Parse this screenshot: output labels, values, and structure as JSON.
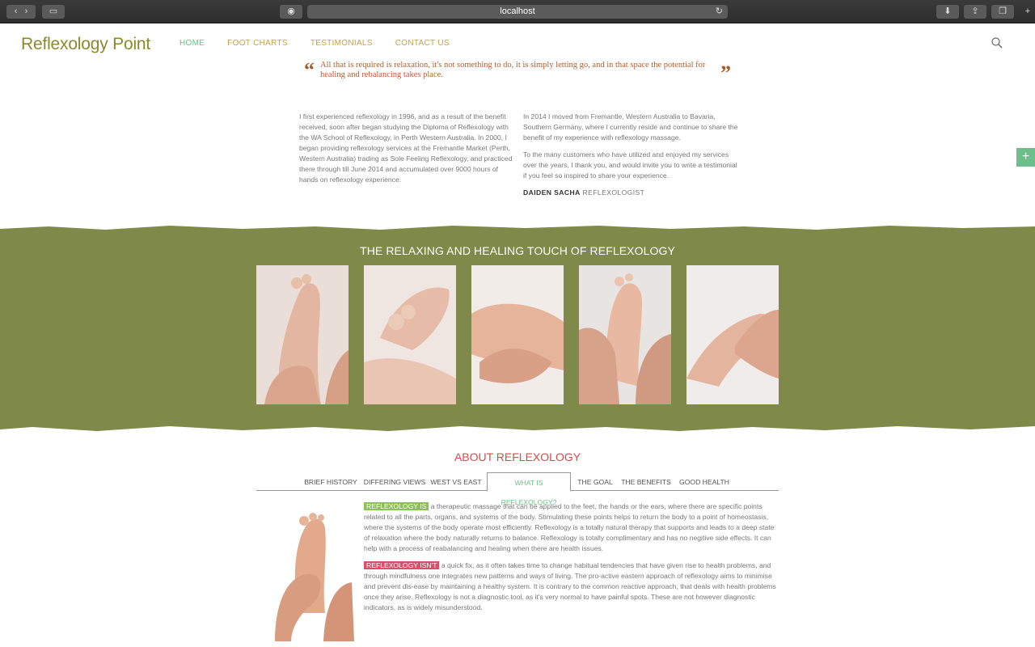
{
  "browser": {
    "url": "localhost"
  },
  "site": {
    "logo": "Reflexology Point",
    "nav": [
      "HOME",
      "FOOT CHARTS",
      "TESTIMONIALS",
      "CONTACT US"
    ],
    "active_nav": "HOME"
  },
  "quote": {
    "text": "All that is required is relaxation, it's not something to do, it is simply letting go, and in that space the potential for healing and rebalancing takes place."
  },
  "intro": {
    "left": "I first experienced reflexology in 1996, and as a result of the benefit received, soon after began studying the Diploma of Reflexology with the WA School of Reflexology, in Perth Western Australia. In 2000, I began providing reflexology services at the Fremantle Market (Perth, Western Australia) trading as Sole Feeling Reflexology, and practiced there through till June 2014 and accumulated over 9000 hours of hands on reflexology experience.",
    "right_p1": "In 2014 I moved from Fremantle, Western Australia to Bavaria, Southern Germany, where I currently reside and continue to share the benefit of my experience with reflexology massage.",
    "right_p2": "To the many customers who have utilized and enjoyed my services over the years, I thank you, and would invite you to write a testimonial if you feel so inspired to share your experience.",
    "signature_name": "DAIDEN SACHA",
    "signature_role": "REFLEXOLOGIST"
  },
  "gallery": {
    "title": "THE RELAXING AND HEALING TOUCH OF REFLEXOLOGY"
  },
  "about": {
    "title": "ABOUT REFLEXOLOGY",
    "tabs": [
      "BRIEF HISTORY",
      "DIFFERING VIEWS",
      "WEST VS EAST",
      "WHAT IS REFLEXOLOGY?",
      "THE GOAL",
      "THE BENEFITS",
      "GOOD HEALTH"
    ],
    "active_tab": "WHAT IS REFLEXOLOGY?",
    "is_label": "REFLEXOLOGY IS",
    "is_text": "a therapeutic massage that can be applied to the feet, the hands or the ears, where there are specific points related to all the parts, organs, and systems of the body. Stimulating these points helps to return the body to a point of homeostasis, where the systems of the body operate most efficiently. Reflexology is a totally natural therapy that supports and leads to a deep state of relaxation where the body naturally returns to balance. Reflexology is totally complimentary and has no negitive side effects. It can help with a process of reabalancing and healing when there are health issues.",
    "isnt_label": "REFLEXOLOGY ISN'T",
    "isnt_text": "a quick fix, as it often takes time to change habitual tendencies that have given rise to health problems, and through mindfulness one integrates new patterns and ways of living. The pro-active eastern approach of reflexology aims to minimise and prevent dis-ease by maintaining a healthy system. It is contrary to the common reactive approach, that deals with health problems once they arise. Reflexology is not a diagnostic tool, as it's very normal to have painful spots. These are not however diagnostic indicators, as is widely misunderstood."
  },
  "colors": {
    "logo": "#8b8a2b",
    "nav_active": "#6bbf8a",
    "nav": "#c8a24a",
    "band": "#7f8a4a",
    "about_title": "#d64a4a",
    "hl_is": "#8cc05a",
    "hl_isnt": "#d6506a"
  }
}
